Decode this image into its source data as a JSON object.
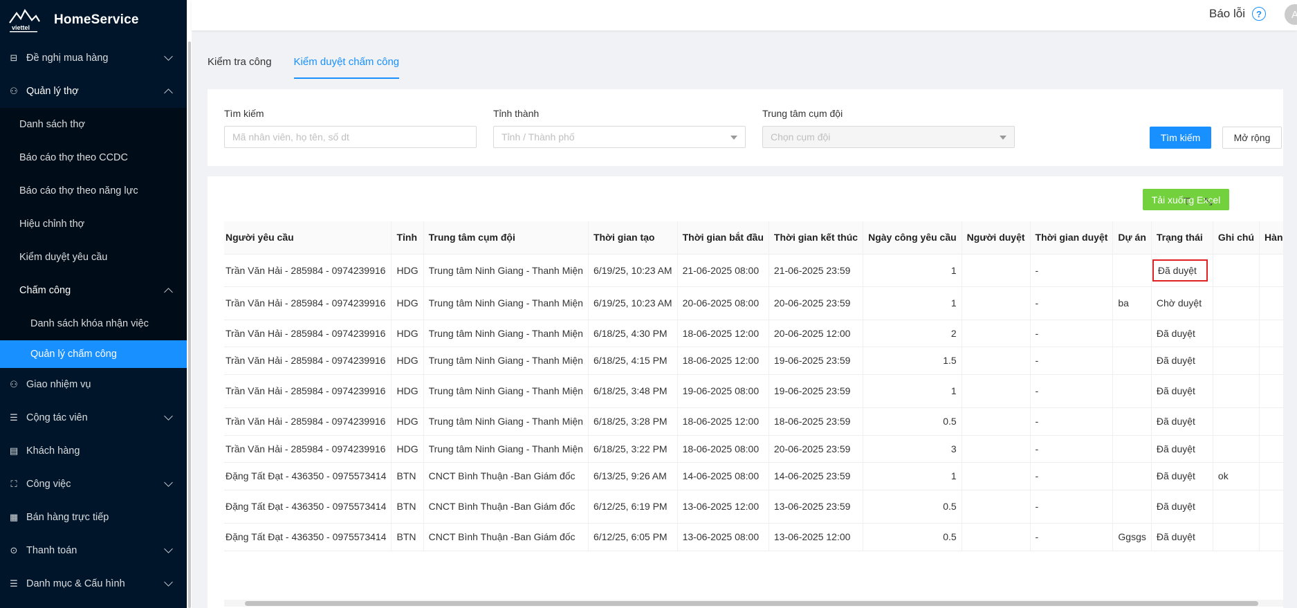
{
  "app": {
    "name": "HomeService",
    "logo_text": "viettel"
  },
  "header": {
    "report_label": "Báo lỗi",
    "avatar_initial": "A"
  },
  "sidebar": {
    "items": [
      {
        "label": "Đề nghị mua hàng",
        "icon": "cart-icon",
        "expandable": true,
        "open": false
      },
      {
        "label": "Quản lý thợ",
        "icon": "worker-icon",
        "expandable": true,
        "open": true
      },
      {
        "label": "Giao nhiệm vụ",
        "icon": "task-icon",
        "expandable": false
      },
      {
        "label": "Cộng tác viên",
        "icon": "list-icon",
        "expandable": true
      },
      {
        "label": "Khách hàng",
        "icon": "customer-icon",
        "expandable": false
      },
      {
        "label": "Công việc",
        "icon": "work-icon",
        "expandable": true
      },
      {
        "label": "Bán hàng trực tiếp",
        "icon": "sales-icon",
        "expandable": false
      },
      {
        "label": "Thanh toán",
        "icon": "payment-icon",
        "expandable": true
      },
      {
        "label": "Danh mục & Cấu hình",
        "icon": "config-icon",
        "expandable": true
      }
    ],
    "worker_sub": [
      "Danh sách thợ",
      "Báo cáo thợ theo CCDC",
      "Báo cáo thợ theo năng lực",
      "Hiệu chỉnh thợ",
      "Kiểm duyệt yêu cầu"
    ],
    "attendance": {
      "label": "Chấm công",
      "sub": [
        "Danh sách khóa nhận việc",
        "Quản lý chấm công"
      ],
      "selected": "Quản lý chấm công"
    }
  },
  "tabs": [
    {
      "label": "Kiểm tra công",
      "active": false
    },
    {
      "label": "Kiểm duyệt chấm công",
      "active": true
    }
  ],
  "filters": {
    "search_label": "Tìm kiếm",
    "search_placeholder": "Mã nhân viên, họ tên, số dt",
    "province_label": "Tỉnh thành",
    "province_placeholder": "Tỉnh / Thành phố",
    "center_label": "Trung tâm cụm đội",
    "center_placeholder": "Chọn cụm đội",
    "search_button": "Tìm kiếm",
    "expand_button": "Mở rộng"
  },
  "table": {
    "excel_button": "Tải xuống Excel",
    "columns": [
      "Người yêu cầu",
      "Tỉnh",
      "Trung tâm cụm đội",
      "Thời gian tạo",
      "Thời gian bắt đầu",
      "Thời gian kết thúc",
      "Ngày công yêu cầu",
      "Người duyệt",
      "Thời gian duyệt",
      "Dự án",
      "Trạng thái",
      "Ghi chú",
      "Hành động"
    ],
    "rows": [
      {
        "requester": "Trần Văn Hải - 285984 - 0974239916",
        "province": "HDG",
        "center": "Trung tâm Ninh Giang - Thanh Miện",
        "created": "6/19/25, 10:23 AM",
        "start": "21-06-2025 08:00",
        "end": "21-06-2025 23:59",
        "days": "1",
        "approver": "",
        "approved_at": "-",
        "project": "",
        "status": "Đã duyệt",
        "note": "",
        "action": ""
      },
      {
        "requester": "Trần Văn Hải - 285984 - 0974239916",
        "province": "HDG",
        "center": "Trung tâm Ninh Giang - Thanh Miện",
        "created": "6/19/25, 10:23 AM",
        "start": "20-06-2025 08:00",
        "end": "20-06-2025 23:59",
        "days": "1",
        "approver": "",
        "approved_at": "-",
        "project": "ba",
        "status": "Chờ duyệt",
        "note": "",
        "action": "delete"
      },
      {
        "requester": "Trần Văn Hải - 285984 - 0974239916",
        "province": "HDG",
        "center": "Trung tâm Ninh Giang - Thanh Miện",
        "created": "6/18/25, 4:30 PM",
        "start": "18-06-2025 12:00",
        "end": "20-06-2025 12:00",
        "days": "2",
        "approver": "",
        "approved_at": "-",
        "project": "",
        "status": "Đã duyệt",
        "note": "",
        "action": ""
      },
      {
        "requester": "Trần Văn Hải - 285984 - 0974239916",
        "province": "HDG",
        "center": "Trung tâm Ninh Giang - Thanh Miện",
        "created": "6/18/25, 4:15 PM",
        "start": "18-06-2025 12:00",
        "end": "19-06-2025 23:59",
        "days": "1.5",
        "approver": "",
        "approved_at": "-",
        "project": "",
        "status": "Đã duyệt",
        "note": "",
        "action": ""
      },
      {
        "requester": "Trần Văn Hải - 285984 - 0974239916",
        "province": "HDG",
        "center": "Trung tâm Ninh Giang - Thanh Miện",
        "created": "6/18/25, 3:48 PM",
        "start": "19-06-2025 08:00",
        "end": "19-06-2025 23:59",
        "days": "1",
        "approver": "",
        "approved_at": "-",
        "project": "",
        "status": "Đã duyệt",
        "note": "",
        "action": "file"
      },
      {
        "requester": "Trần Văn Hải - 285984 - 0974239916",
        "province": "HDG",
        "center": "Trung tâm Ninh Giang - Thanh Miện",
        "created": "6/18/25, 3:28 PM",
        "start": "18-06-2025 12:00",
        "end": "18-06-2025 23:59",
        "days": "0.5",
        "approver": "",
        "approved_at": "-",
        "project": "",
        "status": "Đã duyệt",
        "note": "",
        "action": ""
      },
      {
        "requester": "Trần Văn Hải - 285984 - 0974239916",
        "province": "HDG",
        "center": "Trung tâm Ninh Giang - Thanh Miện",
        "created": "6/18/25, 3:22 PM",
        "start": "18-06-2025 08:00",
        "end": "20-06-2025 23:59",
        "days": "3",
        "approver": "",
        "approved_at": "-",
        "project": "",
        "status": "Đã duyệt",
        "note": "",
        "action": ""
      },
      {
        "requester": "Đặng Tất Đạt - 436350 - 0975573414",
        "province": "BTN",
        "center": "CNCT Bình Thuận -Ban Giám đốc",
        "created": "6/13/25, 9:26 AM",
        "start": "14-06-2025 08:00",
        "end": "14-06-2025 23:59",
        "days": "1",
        "approver": "",
        "approved_at": "-",
        "project": "",
        "status": "Đã duyệt",
        "note": "ok",
        "action": ""
      },
      {
        "requester": "Đặng Tất Đạt - 436350 - 0975573414",
        "province": "BTN",
        "center": "CNCT Bình Thuận -Ban Giám đốc",
        "created": "6/12/25, 6:19 PM",
        "start": "13-06-2025 12:00",
        "end": "13-06-2025 23:59",
        "days": "0.5",
        "approver": "",
        "approved_at": "-",
        "project": "",
        "status": "Đã duyệt",
        "note": "",
        "action": "file"
      },
      {
        "requester": "Đặng Tất Đạt - 436350 - 0975573414",
        "province": "BTN",
        "center": "CNCT Bình Thuận -Ban Giám đốc",
        "created": "6/12/25, 6:05 PM",
        "start": "13-06-2025 08:00",
        "end": "13-06-2025 12:00",
        "days": "0.5",
        "approver": "",
        "approved_at": "-",
        "project": "Ggsgs",
        "status": "Đã duyệt",
        "note": "",
        "action": ""
      }
    ]
  }
}
